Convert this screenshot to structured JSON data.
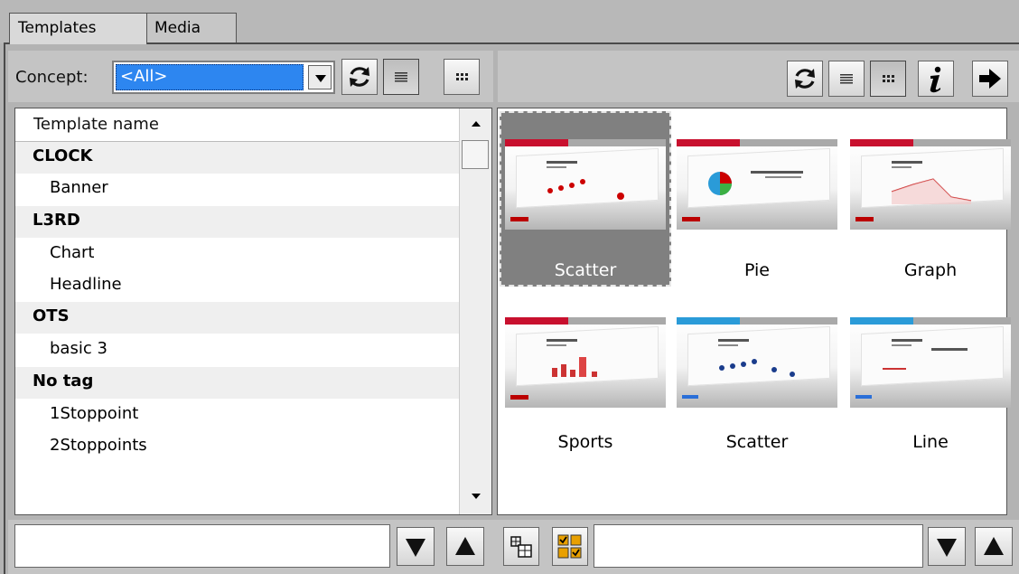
{
  "tabs": [
    {
      "label": "Templates",
      "active": true
    },
    {
      "label": "Media",
      "active": false
    }
  ],
  "concept": {
    "label": "Concept:",
    "value": "<All>"
  },
  "left_toolbar": {
    "icons": [
      "refresh-icon",
      "list-view-icon",
      "grid-view-icon"
    ]
  },
  "right_toolbar": {
    "icons": [
      "refresh-icon",
      "list-view-icon",
      "grid-view-icon",
      "info-icon",
      "arrow-right-icon"
    ]
  },
  "template_list": {
    "header": "Template name",
    "rows": [
      {
        "label": "CLOCK",
        "type": "group"
      },
      {
        "label": "Banner",
        "type": "item"
      },
      {
        "label": "L3RD",
        "type": "group"
      },
      {
        "label": "Chart",
        "type": "item"
      },
      {
        "label": "Headline",
        "type": "item"
      },
      {
        "label": "OTS",
        "type": "group"
      },
      {
        "label": "basic 3",
        "type": "item"
      },
      {
        "label": "No tag",
        "type": "group"
      },
      {
        "label": "1Stoppoint",
        "type": "item"
      },
      {
        "label": "2Stoppoints",
        "type": "item"
      }
    ]
  },
  "thumbnails": [
    {
      "caption": "Scatter",
      "selected": true,
      "accent": "#c8102e"
    },
    {
      "caption": "Pie",
      "selected": false,
      "accent": "#c8102e"
    },
    {
      "caption": "Graph",
      "selected": false,
      "accent": "#c8102e"
    },
    {
      "caption": "Sports",
      "selected": false,
      "accent": "#c8102e"
    },
    {
      "caption": "Scatter",
      "selected": false,
      "accent": "#2a9bd8"
    },
    {
      "caption": "Line",
      "selected": false,
      "accent": "#2a9bd8"
    }
  ],
  "colors": {
    "selection": "#2d86f0",
    "panel": "#c4c4c4",
    "selected_tile": "#808080"
  }
}
